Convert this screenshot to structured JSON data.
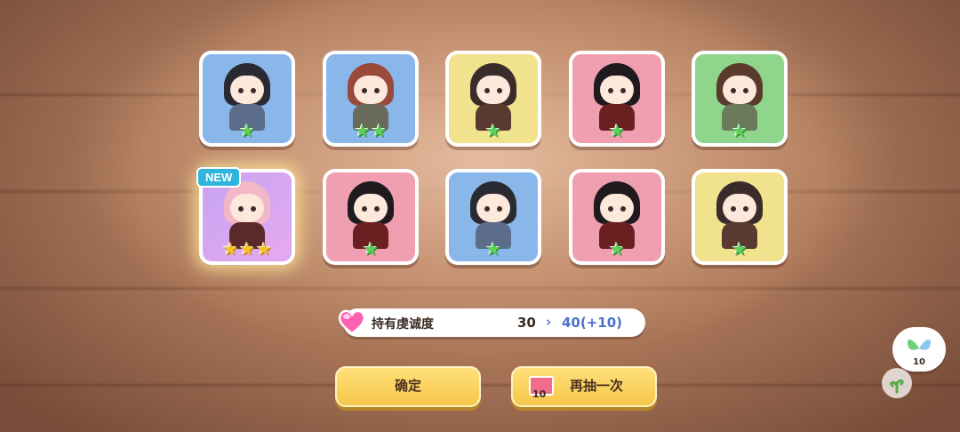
{
  "cards": [
    {
      "color": "blue",
      "stars": 1,
      "hair": "#2a2a33",
      "outfit": "#5b6d8a"
    },
    {
      "color": "blue",
      "stars": 2,
      "hair": "#9a4a3a",
      "outfit": "#6a6a5a"
    },
    {
      "color": "yellow",
      "stars": 1,
      "hair": "#3a2c2a",
      "outfit": "#5a3a30"
    },
    {
      "color": "pink",
      "stars": 1,
      "hair": "#1e1a1e",
      "outfit": "#6a2020"
    },
    {
      "color": "green",
      "stars": 1,
      "hair": "#5a3a2a",
      "outfit": "#6a7a5a"
    },
    {
      "color": "purple",
      "stars": 3,
      "hair": "#f2b8c8",
      "outfit": "#5a2a2a",
      "is_new": true,
      "new_label": "NEW"
    },
    {
      "color": "pink",
      "stars": 1,
      "hair": "#1e1a1e",
      "outfit": "#6a2020"
    },
    {
      "color": "blue",
      "stars": 1,
      "hair": "#2a2a33",
      "outfit": "#5b6d8a"
    },
    {
      "color": "pink",
      "stars": 1,
      "hair": "#1e1a1e",
      "outfit": "#6a2020"
    },
    {
      "color": "yellow",
      "stars": 1,
      "hair": "#3a2c2a",
      "outfit": "#5a3a30"
    }
  ],
  "devotion": {
    "label": "持有虔诚度",
    "current": "30",
    "arrow": "›",
    "new_value": "40(+10)",
    "icon": "heart-gem-icon"
  },
  "buttons": {
    "confirm": "确定",
    "draw_again": "再抽一次",
    "ticket_count": "10",
    "ticket_icon": "ticket-icon"
  },
  "side_widget": {
    "count": "10",
    "icon": "leaf-butterfly-icon",
    "secondary_icon": "sprout-icon"
  }
}
